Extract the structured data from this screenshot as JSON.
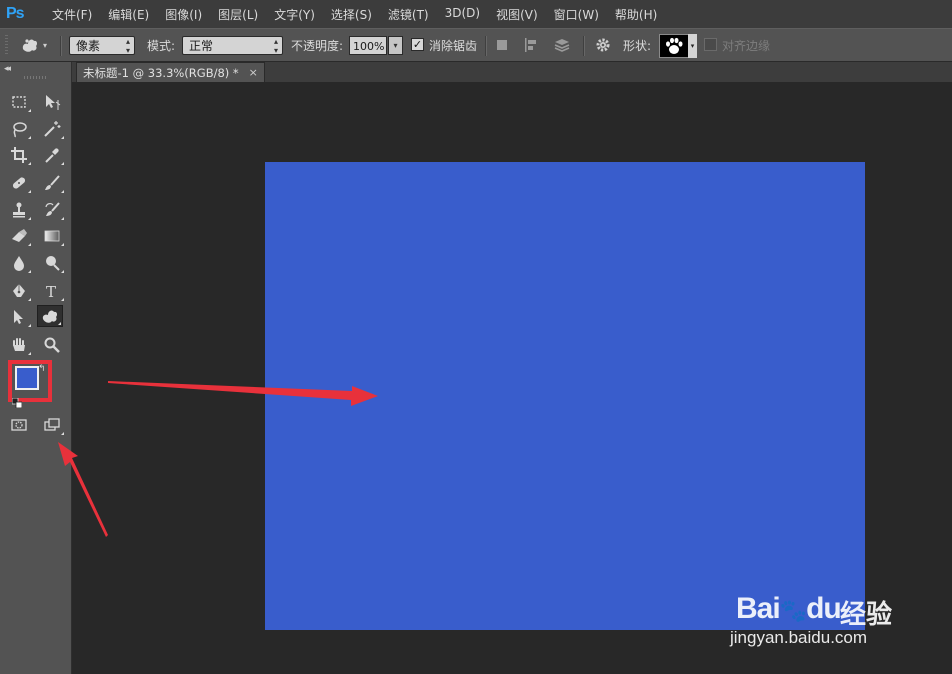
{
  "app": {
    "logo_text": "Ps"
  },
  "menu": [
    {
      "label": "文件(F)"
    },
    {
      "label": "编辑(E)"
    },
    {
      "label": "图像(I)"
    },
    {
      "label": "图层(L)"
    },
    {
      "label": "文字(Y)"
    },
    {
      "label": "选择(S)"
    },
    {
      "label": "滤镜(T)"
    },
    {
      "label": "3D(D)"
    },
    {
      "label": "视图(V)"
    },
    {
      "label": "窗口(W)"
    },
    {
      "label": "帮助(H)"
    }
  ],
  "options": {
    "tool_icon": "custom-shape-tool-icon",
    "mode_select_value": "像素",
    "blend_label": "模式:",
    "blend_select_value": "正常",
    "opacity_label": "不透明度:",
    "opacity_value": "100%",
    "antialias_checked": true,
    "antialias_label": "消除锯齿",
    "shape_label": "形状:",
    "shape_icon": "paw-print-icon",
    "align_edges_checked": false,
    "align_edges_label": "对齐边缘"
  },
  "document": {
    "tab_label": "未标题-1 @ 33.3%(RGB/8) *",
    "close_glyph": "×",
    "fill_color": "#395dcc",
    "background_color": "#282828"
  },
  "toolbar": {
    "foreground_color": "#395dcc",
    "background_color": "#ffffff",
    "highlight_color": "#e8313b"
  },
  "annotations": {
    "arrow_color": "#e8313b"
  },
  "watermark": {
    "brand": "Bai",
    "brand_suffix": "du",
    "cn_text": "经验",
    "url": "jingyan.baidu.com"
  }
}
